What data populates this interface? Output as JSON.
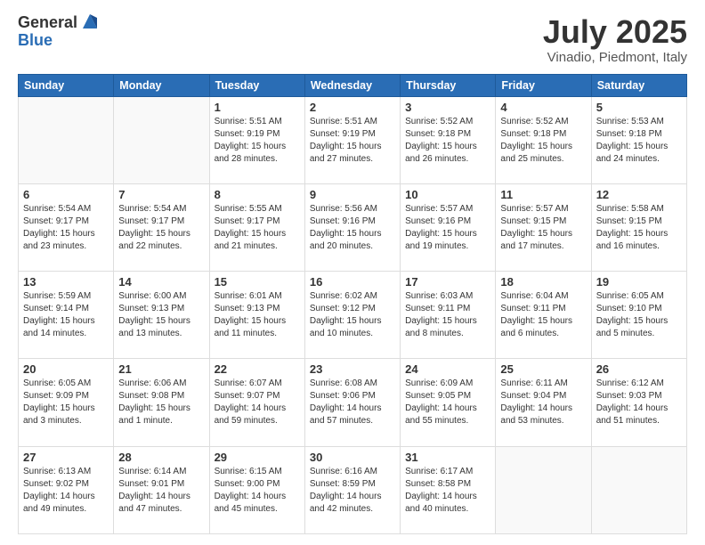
{
  "logo": {
    "general": "General",
    "blue": "Blue"
  },
  "header": {
    "month": "July 2025",
    "location": "Vinadio, Piedmont, Italy"
  },
  "days": [
    "Sunday",
    "Monday",
    "Tuesday",
    "Wednesday",
    "Thursday",
    "Friday",
    "Saturday"
  ],
  "weeks": [
    [
      {
        "day": "",
        "sunrise": "",
        "sunset": "",
        "daylight": ""
      },
      {
        "day": "",
        "sunrise": "",
        "sunset": "",
        "daylight": ""
      },
      {
        "day": "1",
        "sunrise": "Sunrise: 5:51 AM",
        "sunset": "Sunset: 9:19 PM",
        "daylight": "Daylight: 15 hours and 28 minutes."
      },
      {
        "day": "2",
        "sunrise": "Sunrise: 5:51 AM",
        "sunset": "Sunset: 9:19 PM",
        "daylight": "Daylight: 15 hours and 27 minutes."
      },
      {
        "day": "3",
        "sunrise": "Sunrise: 5:52 AM",
        "sunset": "Sunset: 9:18 PM",
        "daylight": "Daylight: 15 hours and 26 minutes."
      },
      {
        "day": "4",
        "sunrise": "Sunrise: 5:52 AM",
        "sunset": "Sunset: 9:18 PM",
        "daylight": "Daylight: 15 hours and 25 minutes."
      },
      {
        "day": "5",
        "sunrise": "Sunrise: 5:53 AM",
        "sunset": "Sunset: 9:18 PM",
        "daylight": "Daylight: 15 hours and 24 minutes."
      }
    ],
    [
      {
        "day": "6",
        "sunrise": "Sunrise: 5:54 AM",
        "sunset": "Sunset: 9:17 PM",
        "daylight": "Daylight: 15 hours and 23 minutes."
      },
      {
        "day": "7",
        "sunrise": "Sunrise: 5:54 AM",
        "sunset": "Sunset: 9:17 PM",
        "daylight": "Daylight: 15 hours and 22 minutes."
      },
      {
        "day": "8",
        "sunrise": "Sunrise: 5:55 AM",
        "sunset": "Sunset: 9:17 PM",
        "daylight": "Daylight: 15 hours and 21 minutes."
      },
      {
        "day": "9",
        "sunrise": "Sunrise: 5:56 AM",
        "sunset": "Sunset: 9:16 PM",
        "daylight": "Daylight: 15 hours and 20 minutes."
      },
      {
        "day": "10",
        "sunrise": "Sunrise: 5:57 AM",
        "sunset": "Sunset: 9:16 PM",
        "daylight": "Daylight: 15 hours and 19 minutes."
      },
      {
        "day": "11",
        "sunrise": "Sunrise: 5:57 AM",
        "sunset": "Sunset: 9:15 PM",
        "daylight": "Daylight: 15 hours and 17 minutes."
      },
      {
        "day": "12",
        "sunrise": "Sunrise: 5:58 AM",
        "sunset": "Sunset: 9:15 PM",
        "daylight": "Daylight: 15 hours and 16 minutes."
      }
    ],
    [
      {
        "day": "13",
        "sunrise": "Sunrise: 5:59 AM",
        "sunset": "Sunset: 9:14 PM",
        "daylight": "Daylight: 15 hours and 14 minutes."
      },
      {
        "day": "14",
        "sunrise": "Sunrise: 6:00 AM",
        "sunset": "Sunset: 9:13 PM",
        "daylight": "Daylight: 15 hours and 13 minutes."
      },
      {
        "day": "15",
        "sunrise": "Sunrise: 6:01 AM",
        "sunset": "Sunset: 9:13 PM",
        "daylight": "Daylight: 15 hours and 11 minutes."
      },
      {
        "day": "16",
        "sunrise": "Sunrise: 6:02 AM",
        "sunset": "Sunset: 9:12 PM",
        "daylight": "Daylight: 15 hours and 10 minutes."
      },
      {
        "day": "17",
        "sunrise": "Sunrise: 6:03 AM",
        "sunset": "Sunset: 9:11 PM",
        "daylight": "Daylight: 15 hours and 8 minutes."
      },
      {
        "day": "18",
        "sunrise": "Sunrise: 6:04 AM",
        "sunset": "Sunset: 9:11 PM",
        "daylight": "Daylight: 15 hours and 6 minutes."
      },
      {
        "day": "19",
        "sunrise": "Sunrise: 6:05 AM",
        "sunset": "Sunset: 9:10 PM",
        "daylight": "Daylight: 15 hours and 5 minutes."
      }
    ],
    [
      {
        "day": "20",
        "sunrise": "Sunrise: 6:05 AM",
        "sunset": "Sunset: 9:09 PM",
        "daylight": "Daylight: 15 hours and 3 minutes."
      },
      {
        "day": "21",
        "sunrise": "Sunrise: 6:06 AM",
        "sunset": "Sunset: 9:08 PM",
        "daylight": "Daylight: 15 hours and 1 minute."
      },
      {
        "day": "22",
        "sunrise": "Sunrise: 6:07 AM",
        "sunset": "Sunset: 9:07 PM",
        "daylight": "Daylight: 14 hours and 59 minutes."
      },
      {
        "day": "23",
        "sunrise": "Sunrise: 6:08 AM",
        "sunset": "Sunset: 9:06 PM",
        "daylight": "Daylight: 14 hours and 57 minutes."
      },
      {
        "day": "24",
        "sunrise": "Sunrise: 6:09 AM",
        "sunset": "Sunset: 9:05 PM",
        "daylight": "Daylight: 14 hours and 55 minutes."
      },
      {
        "day": "25",
        "sunrise": "Sunrise: 6:11 AM",
        "sunset": "Sunset: 9:04 PM",
        "daylight": "Daylight: 14 hours and 53 minutes."
      },
      {
        "day": "26",
        "sunrise": "Sunrise: 6:12 AM",
        "sunset": "Sunset: 9:03 PM",
        "daylight": "Daylight: 14 hours and 51 minutes."
      }
    ],
    [
      {
        "day": "27",
        "sunrise": "Sunrise: 6:13 AM",
        "sunset": "Sunset: 9:02 PM",
        "daylight": "Daylight: 14 hours and 49 minutes."
      },
      {
        "day": "28",
        "sunrise": "Sunrise: 6:14 AM",
        "sunset": "Sunset: 9:01 PM",
        "daylight": "Daylight: 14 hours and 47 minutes."
      },
      {
        "day": "29",
        "sunrise": "Sunrise: 6:15 AM",
        "sunset": "Sunset: 9:00 PM",
        "daylight": "Daylight: 14 hours and 45 minutes."
      },
      {
        "day": "30",
        "sunrise": "Sunrise: 6:16 AM",
        "sunset": "Sunset: 8:59 PM",
        "daylight": "Daylight: 14 hours and 42 minutes."
      },
      {
        "day": "31",
        "sunrise": "Sunrise: 6:17 AM",
        "sunset": "Sunset: 8:58 PM",
        "daylight": "Daylight: 14 hours and 40 minutes."
      },
      {
        "day": "",
        "sunrise": "",
        "sunset": "",
        "daylight": ""
      },
      {
        "day": "",
        "sunrise": "",
        "sunset": "",
        "daylight": ""
      }
    ]
  ]
}
